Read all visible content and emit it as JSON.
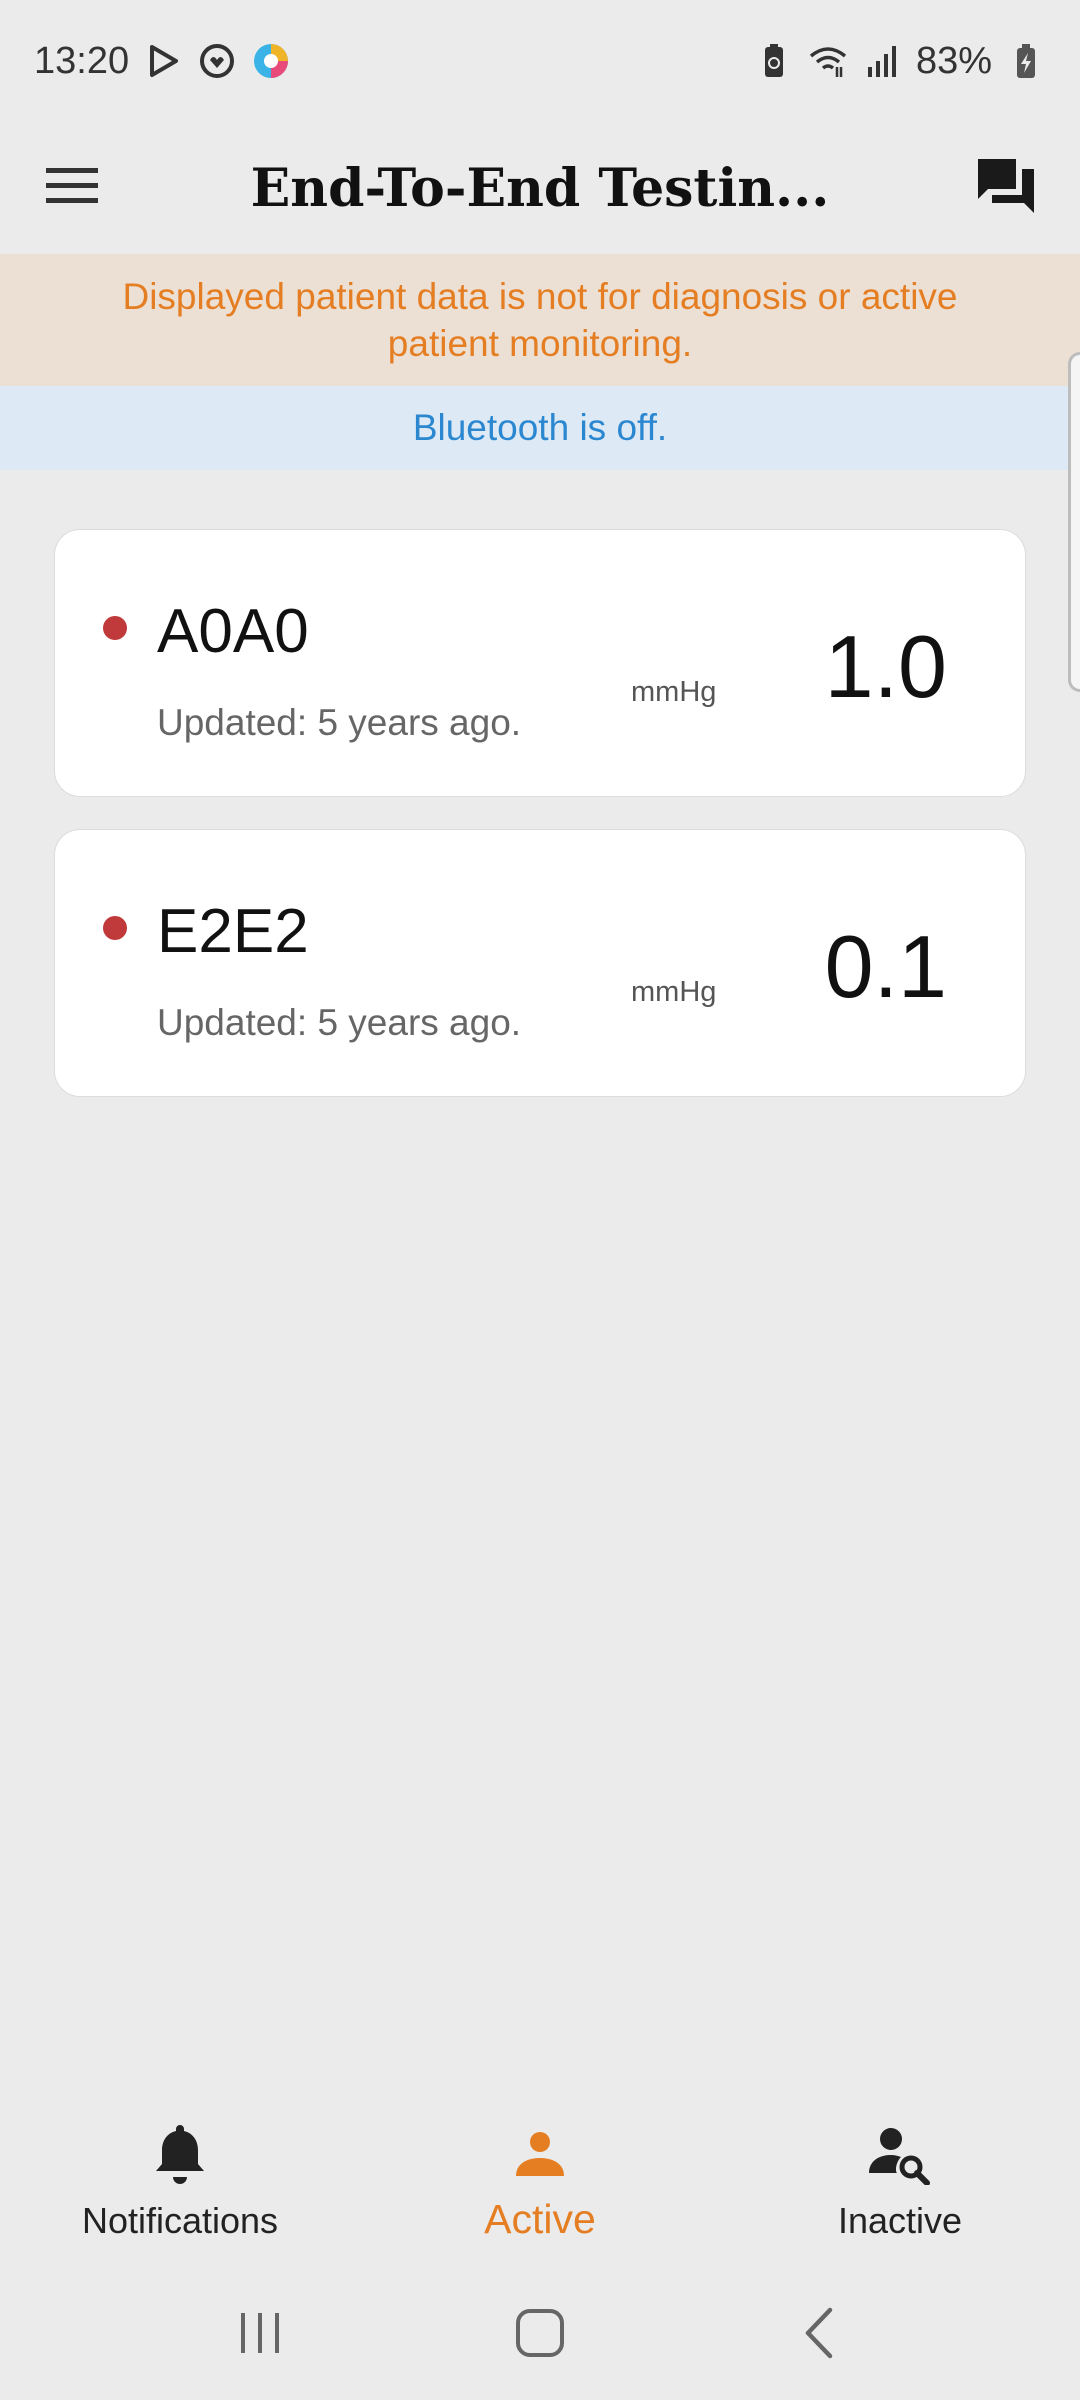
{
  "status_bar": {
    "time": "13:20",
    "battery": "83%",
    "left_icons": [
      "play-store-icon",
      "health-icon",
      "app-logo-icon"
    ],
    "right_icons": [
      "battery-saver-icon",
      "wifi-icon",
      "signal-icon",
      "battery-icon"
    ]
  },
  "app_bar": {
    "title": "End-To-End Testin...",
    "menu_icon": "hamburger-menu-icon",
    "chat_icon": "chat-icon"
  },
  "banners": {
    "warning": "Displayed patient data is not for diagnosis or active patient monitoring.",
    "bluetooth": "Bluetooth is off."
  },
  "patients": [
    {
      "name": "A0A0",
      "updated": "Updated: 5 years ago.",
      "unit": "mmHg",
      "value": "1.0"
    },
    {
      "name": "E2E2",
      "updated": "Updated: 5 years ago.",
      "unit": "mmHg",
      "value": "0.1"
    }
  ],
  "bottom_nav": {
    "items": [
      {
        "label": "Notifications",
        "icon": "bell-icon"
      },
      {
        "label": "Active",
        "icon": "person-icon"
      },
      {
        "label": "Inactive",
        "icon": "person-search-icon"
      }
    ],
    "active_index": 1
  },
  "colors": {
    "accent": "#e57e22",
    "warning_bg": "#ece0d5",
    "info_bg": "#dde9f4",
    "info_text": "#2a87d0",
    "status_dot": "#c0393b"
  }
}
